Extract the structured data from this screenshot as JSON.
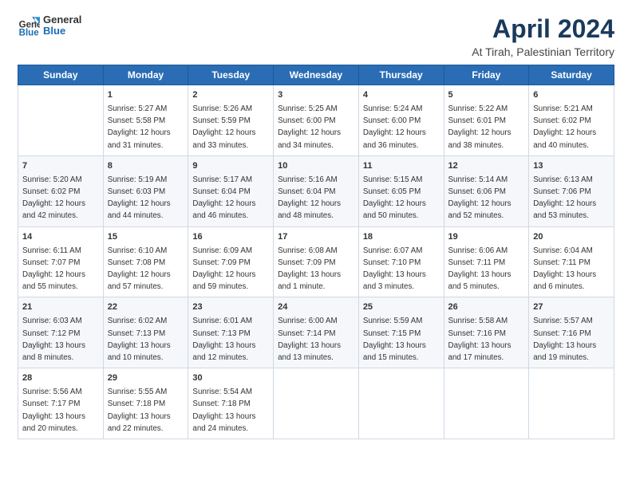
{
  "logo": {
    "general": "General",
    "blue": "Blue"
  },
  "title": "April 2024",
  "subtitle": "At Tirah, Palestinian Territory",
  "days_of_week": [
    "Sunday",
    "Monday",
    "Tuesday",
    "Wednesday",
    "Thursday",
    "Friday",
    "Saturday"
  ],
  "weeks": [
    [
      {
        "day": "",
        "info": ""
      },
      {
        "day": "1",
        "info": "Sunrise: 5:27 AM\nSunset: 5:58 PM\nDaylight: 12 hours\nand 31 minutes."
      },
      {
        "day": "2",
        "info": "Sunrise: 5:26 AM\nSunset: 5:59 PM\nDaylight: 12 hours\nand 33 minutes."
      },
      {
        "day": "3",
        "info": "Sunrise: 5:25 AM\nSunset: 6:00 PM\nDaylight: 12 hours\nand 34 minutes."
      },
      {
        "day": "4",
        "info": "Sunrise: 5:24 AM\nSunset: 6:00 PM\nDaylight: 12 hours\nand 36 minutes."
      },
      {
        "day": "5",
        "info": "Sunrise: 5:22 AM\nSunset: 6:01 PM\nDaylight: 12 hours\nand 38 minutes."
      },
      {
        "day": "6",
        "info": "Sunrise: 5:21 AM\nSunset: 6:02 PM\nDaylight: 12 hours\nand 40 minutes."
      }
    ],
    [
      {
        "day": "7",
        "info": "Sunrise: 5:20 AM\nSunset: 6:02 PM\nDaylight: 12 hours\nand 42 minutes."
      },
      {
        "day": "8",
        "info": "Sunrise: 5:19 AM\nSunset: 6:03 PM\nDaylight: 12 hours\nand 44 minutes."
      },
      {
        "day": "9",
        "info": "Sunrise: 5:17 AM\nSunset: 6:04 PM\nDaylight: 12 hours\nand 46 minutes."
      },
      {
        "day": "10",
        "info": "Sunrise: 5:16 AM\nSunset: 6:04 PM\nDaylight: 12 hours\nand 48 minutes."
      },
      {
        "day": "11",
        "info": "Sunrise: 5:15 AM\nSunset: 6:05 PM\nDaylight: 12 hours\nand 50 minutes."
      },
      {
        "day": "12",
        "info": "Sunrise: 5:14 AM\nSunset: 6:06 PM\nDaylight: 12 hours\nand 52 minutes."
      },
      {
        "day": "13",
        "info": "Sunrise: 6:13 AM\nSunset: 7:06 PM\nDaylight: 12 hours\nand 53 minutes."
      }
    ],
    [
      {
        "day": "14",
        "info": "Sunrise: 6:11 AM\nSunset: 7:07 PM\nDaylight: 12 hours\nand 55 minutes."
      },
      {
        "day": "15",
        "info": "Sunrise: 6:10 AM\nSunset: 7:08 PM\nDaylight: 12 hours\nand 57 minutes."
      },
      {
        "day": "16",
        "info": "Sunrise: 6:09 AM\nSunset: 7:09 PM\nDaylight: 12 hours\nand 59 minutes."
      },
      {
        "day": "17",
        "info": "Sunrise: 6:08 AM\nSunset: 7:09 PM\nDaylight: 13 hours\nand 1 minute."
      },
      {
        "day": "18",
        "info": "Sunrise: 6:07 AM\nSunset: 7:10 PM\nDaylight: 13 hours\nand 3 minutes."
      },
      {
        "day": "19",
        "info": "Sunrise: 6:06 AM\nSunset: 7:11 PM\nDaylight: 13 hours\nand 5 minutes."
      },
      {
        "day": "20",
        "info": "Sunrise: 6:04 AM\nSunset: 7:11 PM\nDaylight: 13 hours\nand 6 minutes."
      }
    ],
    [
      {
        "day": "21",
        "info": "Sunrise: 6:03 AM\nSunset: 7:12 PM\nDaylight: 13 hours\nand 8 minutes."
      },
      {
        "day": "22",
        "info": "Sunrise: 6:02 AM\nSunset: 7:13 PM\nDaylight: 13 hours\nand 10 minutes."
      },
      {
        "day": "23",
        "info": "Sunrise: 6:01 AM\nSunset: 7:13 PM\nDaylight: 13 hours\nand 12 minutes."
      },
      {
        "day": "24",
        "info": "Sunrise: 6:00 AM\nSunset: 7:14 PM\nDaylight: 13 hours\nand 13 minutes."
      },
      {
        "day": "25",
        "info": "Sunrise: 5:59 AM\nSunset: 7:15 PM\nDaylight: 13 hours\nand 15 minutes."
      },
      {
        "day": "26",
        "info": "Sunrise: 5:58 AM\nSunset: 7:16 PM\nDaylight: 13 hours\nand 17 minutes."
      },
      {
        "day": "27",
        "info": "Sunrise: 5:57 AM\nSunset: 7:16 PM\nDaylight: 13 hours\nand 19 minutes."
      }
    ],
    [
      {
        "day": "28",
        "info": "Sunrise: 5:56 AM\nSunset: 7:17 PM\nDaylight: 13 hours\nand 20 minutes."
      },
      {
        "day": "29",
        "info": "Sunrise: 5:55 AM\nSunset: 7:18 PM\nDaylight: 13 hours\nand 22 minutes."
      },
      {
        "day": "30",
        "info": "Sunrise: 5:54 AM\nSunset: 7:18 PM\nDaylight: 13 hours\nand 24 minutes."
      },
      {
        "day": "",
        "info": ""
      },
      {
        "day": "",
        "info": ""
      },
      {
        "day": "",
        "info": ""
      },
      {
        "day": "",
        "info": ""
      }
    ]
  ]
}
